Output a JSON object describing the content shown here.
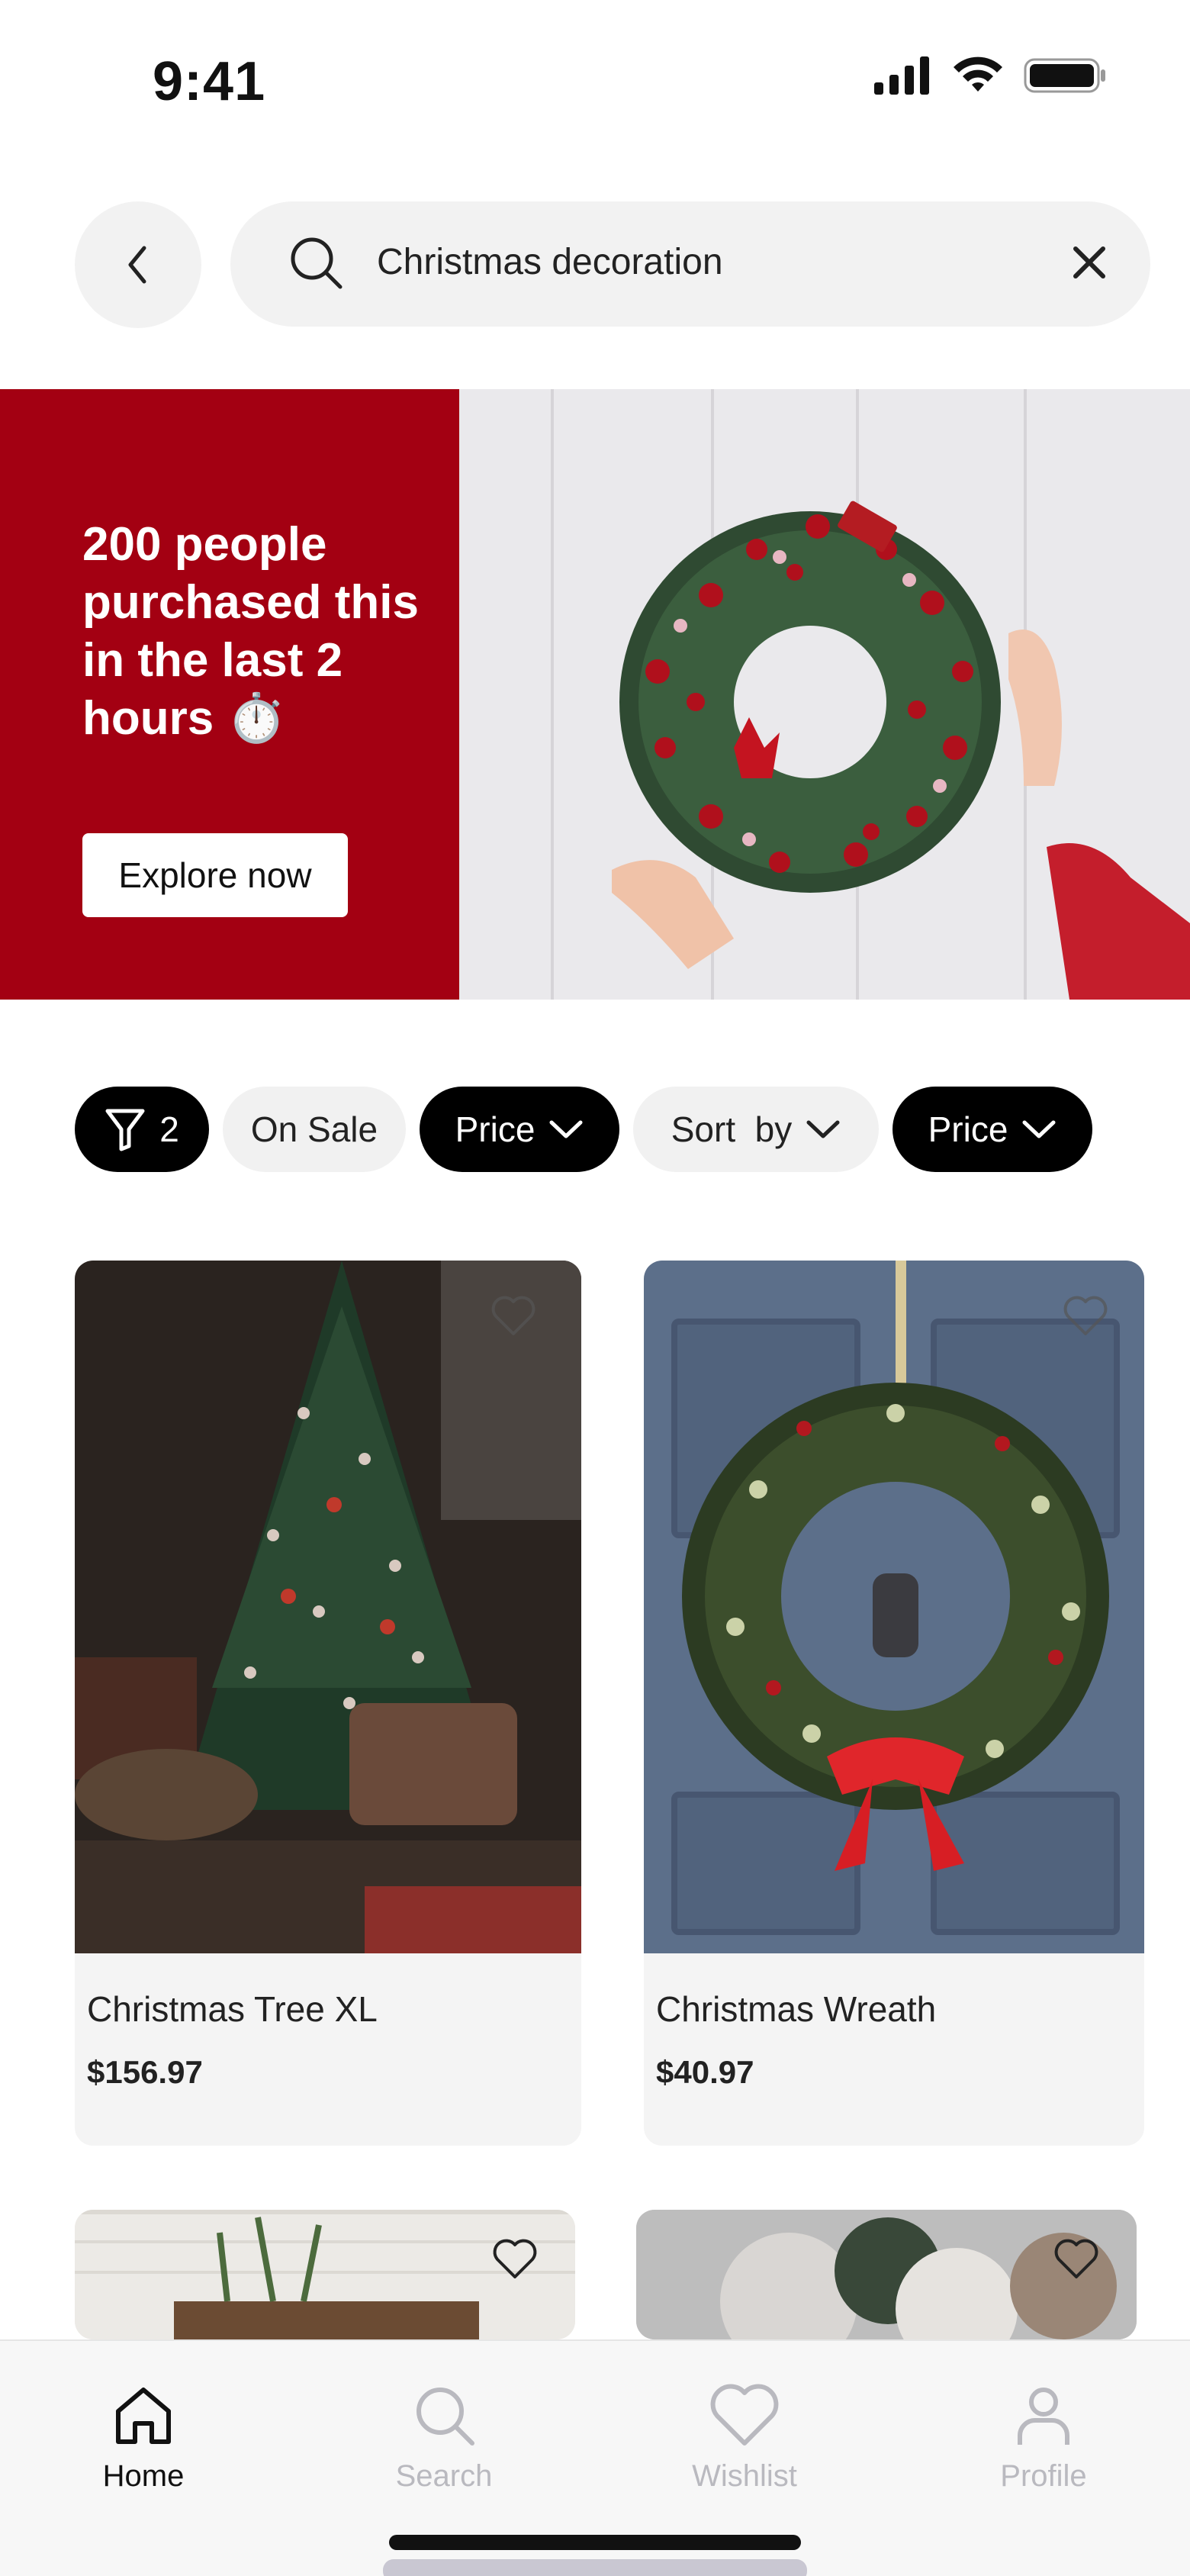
{
  "status_bar": {
    "time": "9:41"
  },
  "search": {
    "query": "Christmas decoration"
  },
  "banner": {
    "text": "200 people purchased this in the last 2 hours ⏱️",
    "button_label": "Explore now",
    "accent_color": "#a30012"
  },
  "filters": {
    "count": "2",
    "chips": [
      "On Sale",
      "Price",
      "Sort  by",
      "Price"
    ]
  },
  "products": [
    {
      "name": "Christmas Tree XL",
      "price": "$156.97"
    },
    {
      "name": "Christmas Wreath",
      "price": "$40.97"
    }
  ],
  "bottom_nav": {
    "items": [
      {
        "label": "Home",
        "icon": "home-icon",
        "active": true
      },
      {
        "label": "Search",
        "icon": "search-icon",
        "active": false
      },
      {
        "label": "Wishlist",
        "icon": "heart-icon",
        "active": false
      },
      {
        "label": "Profile",
        "icon": "profile-icon",
        "active": false
      }
    ]
  }
}
